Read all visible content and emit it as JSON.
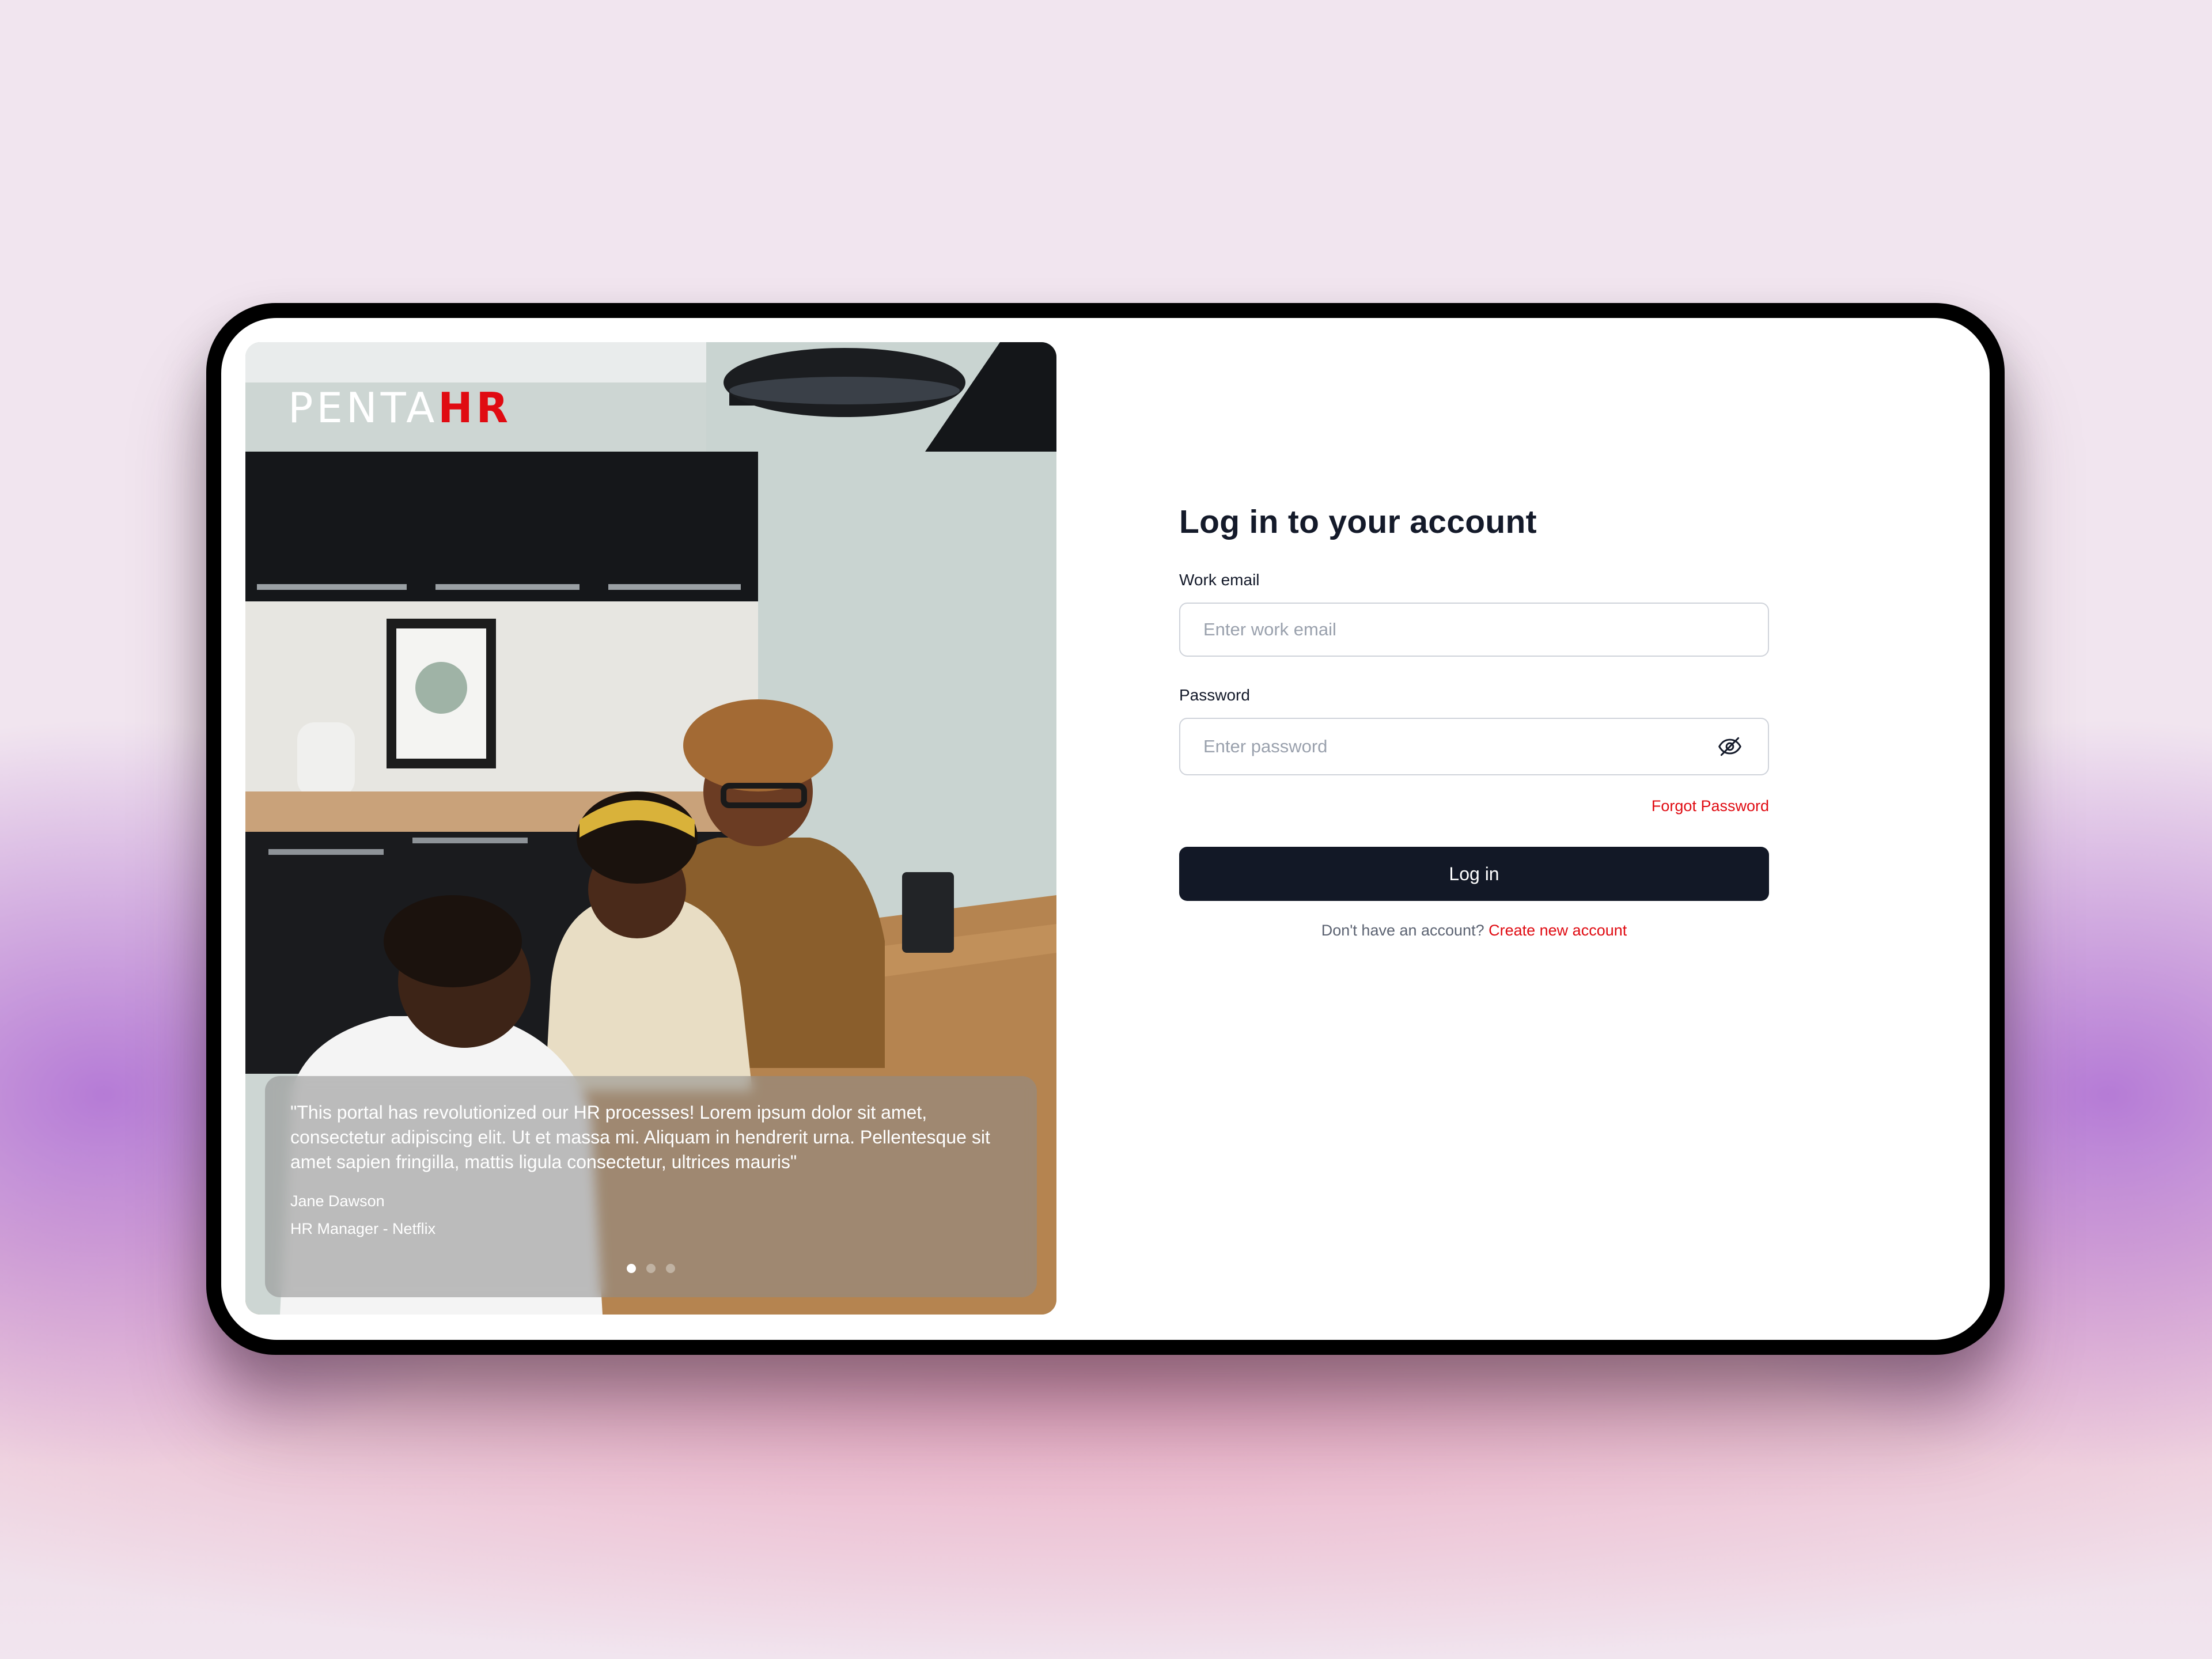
{
  "brand": {
    "logo_main": "PENTA",
    "logo_accent": "HR",
    "accent_color": "#e00b12",
    "dark_color": "#121826"
  },
  "testimonial": {
    "quote": "\"This portal has revolutionized our HR processes! Lorem ipsum dolor sit amet, consectetur adipiscing elit. Ut et massa mi. Aliquam in hendrerit urna. Pellentesque sit amet sapien fringilla, mattis ligula consectetur, ultrices mauris\"",
    "author": "Jane Dawson",
    "role": "HR Manager - Netflix",
    "slides_total": 3,
    "active_slide": 1
  },
  "form": {
    "title": "Log in to your account",
    "email_label": "Work email",
    "email_placeholder": "Enter work email",
    "email_value": "",
    "password_label": "Password",
    "password_placeholder": "Enter password",
    "password_value": "",
    "password_toggle_icon": "eye-off-icon",
    "forgot_label": "Forgot Password",
    "login_label": "Log in",
    "signup_prompt": "Don't have an account?",
    "signup_link": "Create new account"
  }
}
